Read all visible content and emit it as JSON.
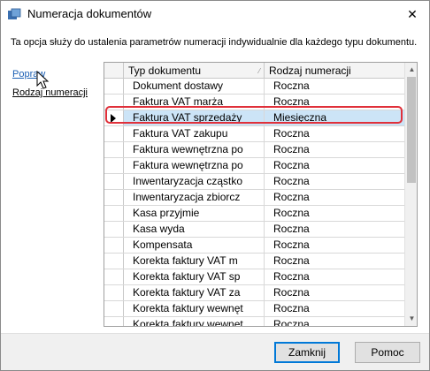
{
  "window": {
    "title": "Numeracja dokumentów",
    "close_glyph": "✕"
  },
  "description": "Ta opcja służy do ustalenia parametrów numeracji indywidualnie dla każdego typu dokumentu.",
  "sidebar": {
    "items": [
      {
        "label": "Popraw"
      },
      {
        "label": "Rodzaj numeracji"
      }
    ]
  },
  "grid": {
    "columns": [
      "Typ dokumentu",
      "Rodzaj numeracji"
    ],
    "selected_row_index": 2,
    "rows": [
      [
        "Dokument dostawy",
        "Roczna"
      ],
      [
        "Faktura VAT marża",
        "Roczna"
      ],
      [
        "Faktura VAT sprzedaży",
        "Miesięczna"
      ],
      [
        "Faktura VAT zakupu",
        "Roczna"
      ],
      [
        "Faktura wewnętrzna po",
        "Roczna"
      ],
      [
        "Faktura wewnętrzna po",
        "Roczna"
      ],
      [
        "Inwentaryzacja cząstko",
        "Roczna"
      ],
      [
        "Inwentaryzacja zbiorcz",
        "Roczna"
      ],
      [
        "Kasa przyjmie",
        "Roczna"
      ],
      [
        "Kasa wyda",
        "Roczna"
      ],
      [
        "Kompensata",
        "Roczna"
      ],
      [
        "Korekta faktury VAT m",
        "Roczna"
      ],
      [
        "Korekta faktury VAT sp",
        "Roczna"
      ],
      [
        "Korekta faktury VAT za",
        "Roczna"
      ],
      [
        "Korekta faktury wewnęt",
        "Roczna"
      ],
      [
        "Korekta faktury wewnęt",
        "Roczna"
      ]
    ]
  },
  "scrollbar": {
    "up_glyph": "▲",
    "down_glyph": "▼"
  },
  "buttons": {
    "close_label": "Zamknij",
    "help_label": "Pomoc"
  },
  "colors": {
    "selection": "#cce4f7",
    "highlight_border": "#e0303a",
    "link": "#1a5fb4"
  }
}
